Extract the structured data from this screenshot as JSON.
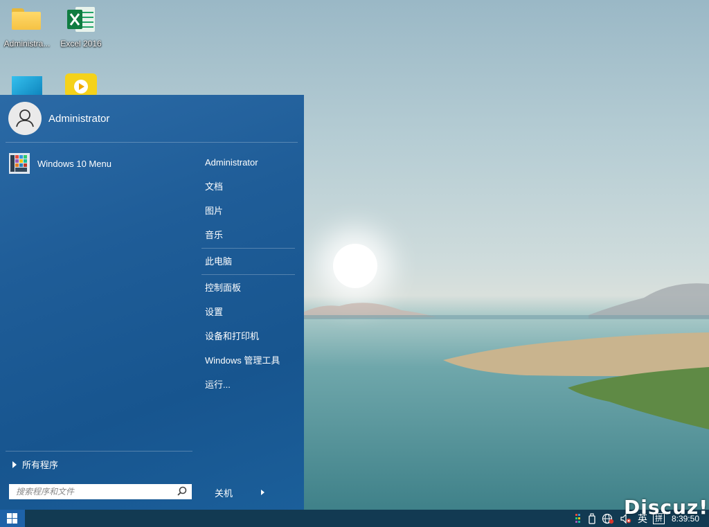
{
  "desktop": {
    "icons": [
      {
        "label": "Administra..."
      },
      {
        "label": "Excel 2016"
      }
    ]
  },
  "start_menu": {
    "user_name": "Administrator",
    "pinned": [
      {
        "label": "Windows 10 Menu"
      }
    ],
    "right_items": [
      {
        "label": "Administrator"
      },
      {
        "label": "文档"
      },
      {
        "label": "图片"
      },
      {
        "label": "音乐"
      },
      {
        "label": "此电脑"
      },
      {
        "label": "控制面板"
      },
      {
        "label": "设置"
      },
      {
        "label": "设备和打印机"
      },
      {
        "label": "Windows 管理工具"
      },
      {
        "label": "运行..."
      }
    ],
    "all_programs": "所有程序",
    "search_placeholder": "搜索程序和文件",
    "shutdown_label": "关机"
  },
  "taskbar": {
    "ime_lang": "英",
    "ime_mode": "拼",
    "clock": "8:39:50"
  },
  "watermark": "Discuz!",
  "colors": {
    "start_menu_bg": "#1f5d98",
    "taskbar_bg": "#123a52",
    "start_button": "#1e62a8"
  }
}
